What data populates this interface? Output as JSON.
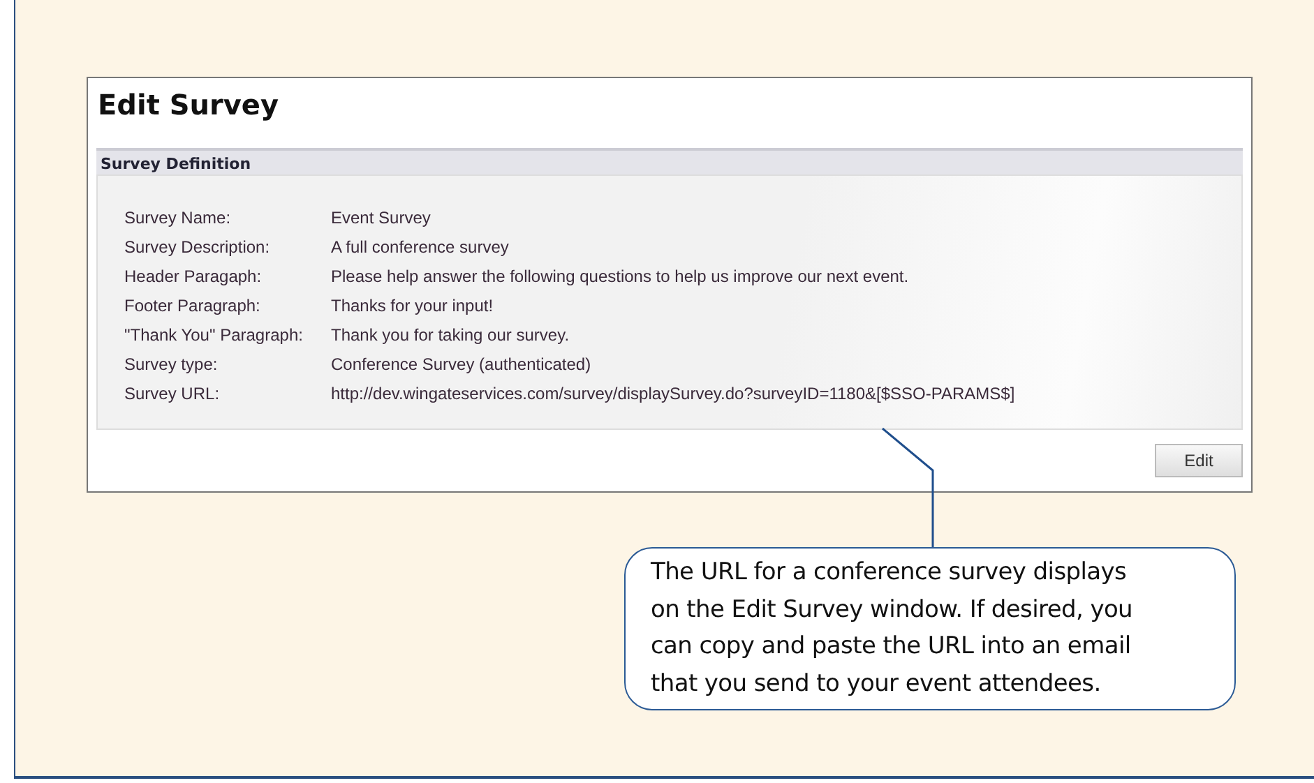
{
  "window": {
    "title": "Edit Survey"
  },
  "section": {
    "title": "Survey Definition"
  },
  "fields": [
    {
      "label": "Survey Name:",
      "value": "Event Survey"
    },
    {
      "label": "Survey Description:",
      "value": "A full conference survey"
    },
    {
      "label": "Header Paragaph:",
      "value": "Please help answer the following questions to help us improve our next event."
    },
    {
      "label": "Footer Paragraph:",
      "value": "Thanks for your input!"
    },
    {
      "label": "\"Thank You\" Paragraph:",
      "value": "Thank you for taking our survey."
    },
    {
      "label": "Survey type:",
      "value": "Conference Survey (authenticated)"
    },
    {
      "label": "Survey URL:",
      "value": "http://dev.wingateservices.com/survey/displaySurvey.do?surveyID=1180&[$SSO-PARAMS$]"
    }
  ],
  "buttons": [
    "Edit"
  ],
  "callout": {
    "lines": [
      "The URL for a conference survey displays",
      "on the Edit Survey window. If desired, you",
      "can copy and paste the URL into an email",
      "that you send to your event attendees."
    ]
  }
}
